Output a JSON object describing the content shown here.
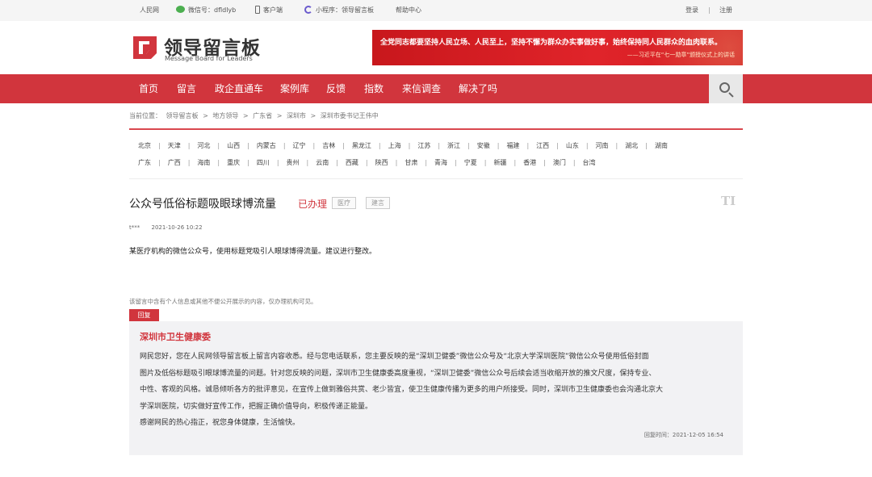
{
  "topbar": {
    "site": "人民网",
    "wechat": "微信号：dfldlyb",
    "client": "客户端",
    "miniprogram": "小程序：领导留言板",
    "help": "帮助中心",
    "login": "登录",
    "sep": "|",
    "register": "注册"
  },
  "header": {
    "logo_title": "领导留言板",
    "logo_subtitle": "Message Board for Leaders",
    "banner_line1": "全党同志都要坚持人民立场、人民至上，坚持不懈为群众办实事做好事，始终保持同人民群众的血肉联系。",
    "banner_line2": "——习近平在“七一勋章”颁授仪式上的讲话"
  },
  "nav": {
    "items": [
      "首页",
      "留言",
      "政企直通车",
      "案例库",
      "反馈",
      "指数",
      "来信调查",
      "解决了吗"
    ]
  },
  "breadcrumb": {
    "prefix": "当前位置：",
    "items": [
      "领导留言板",
      "地方领导",
      "广东省",
      "深圳市",
      "深圳市委书记王伟中"
    ],
    "sep": ">"
  },
  "provinces": {
    "row1": [
      "北京",
      "天津",
      "河北",
      "山西",
      "内蒙古",
      "辽宁",
      "吉林",
      "黑龙江",
      "上海",
      "江苏",
      "浙江",
      "安徽",
      "福建",
      "江西",
      "山东",
      "河南",
      "湖北",
      "湖南"
    ],
    "row2": [
      "广东",
      "广西",
      "海南",
      "重庆",
      "四川",
      "贵州",
      "云南",
      "西藏",
      "陕西",
      "甘肃",
      "青海",
      "宁夏",
      "新疆",
      "香港",
      "澳门",
      "台湾"
    ]
  },
  "post": {
    "title": "公众号低俗标题吸眼球博流量",
    "status": "已办理",
    "tag1": "医疗",
    "tag2": "建言",
    "author": "t***",
    "time": "2021-10-26 10:22",
    "content": "某医疗机构的微信公众号，使用标题党吸引人眼球博得流量。建议进行整改。",
    "privacy_note": "该留言中含有个人信息或其他不便公开展示的内容，仅办理机构可见。"
  },
  "reply": {
    "label": "回复",
    "org": "深圳市卫生健康委",
    "lines": [
      "网民您好，您在人民网领导留言板上留言内容收悉。经与您电话联系，您主要反映的是“深圳卫健委”微信公众号及“北京大学深圳医院”微信公众号使用低俗封面",
      "图片及低俗标题吸引眼球博流量的问题。针对您反映的问题，深圳市卫生健康委高度重视，“深圳卫健委”微信公众号后续会适当收缩开放的推文尺度，保持专业、",
      "中性、客观的风格。诚恳倾听各方的批评意见，在宣传上做到雅俗共赏、老少皆宜，使卫生健康传播为更多的用户所接受。同时，深圳市卫生健康委也会沟通北京大",
      "学深圳医院，切实做好宣传工作，把握正确价值导向，积极传递正能量。",
      "感谢网民的热心指正，祝您身体健康，生活愉快。"
    ],
    "time": "回复时间：2021-12-05 16:54"
  },
  "colors": {
    "brand_red": "#d1353d",
    "banner_red": "#d9242a",
    "reply_bg": "#f2f2f4"
  }
}
